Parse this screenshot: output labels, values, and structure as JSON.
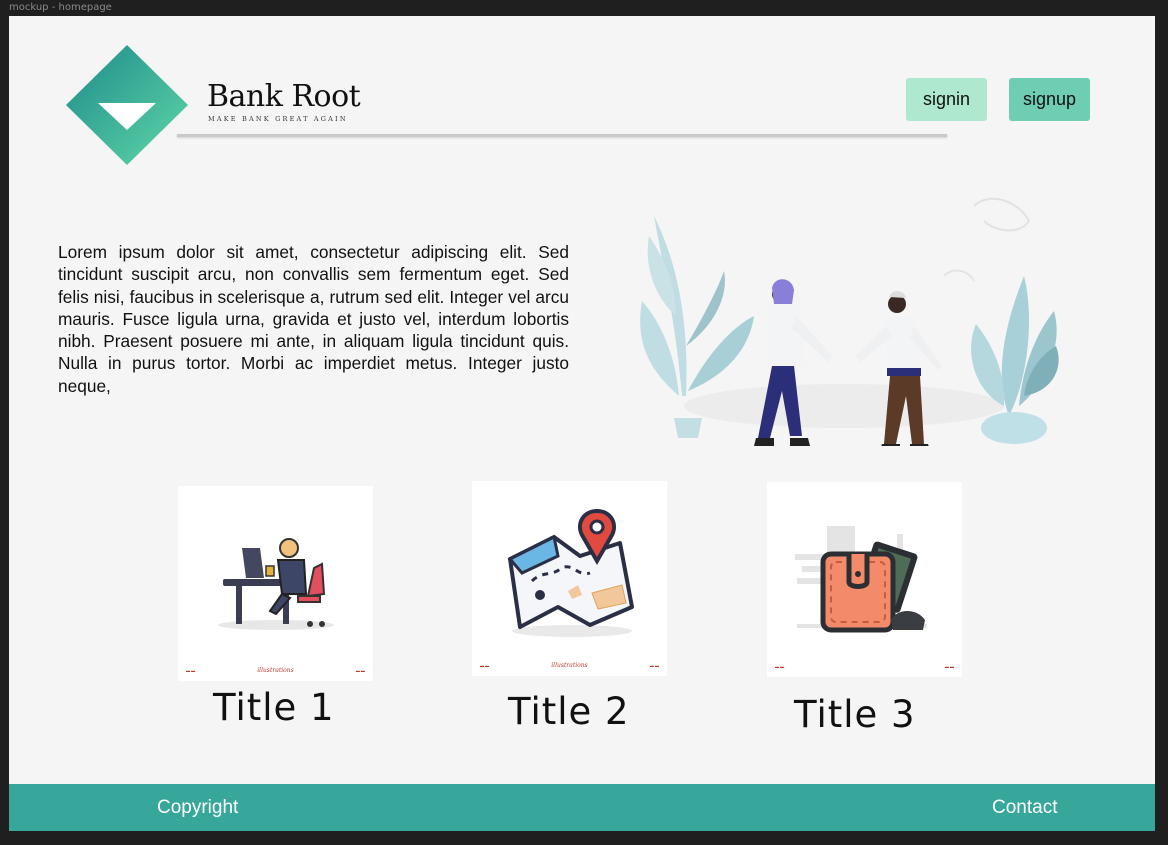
{
  "window": {
    "title": "mockup - homepage"
  },
  "brand": {
    "name": "Bank Root",
    "tagline": "MAKE BANK GREAT AGAIN",
    "gradient": [
      "#1e8a8c",
      "#5fd8a6"
    ]
  },
  "header": {
    "signin_label": "signin",
    "signup_label": "signup",
    "signin_color": "#aee8cf",
    "signup_color": "#6fcdb4"
  },
  "intro": {
    "text": "Lorem ipsum dolor sit amet, consectetur adipiscing elit. Sed tincidunt suscipit arcu, non convallis sem fermentum eget. Sed felis nisi, faucibus in scelerisque a, rutrum sed elit. Integer vel arcu mauris. Fusce ligula urna, gravida et justo vel, interdum lobortis nibh. Praesent posuere mi ante, in aliquam ligula tincidunt quis. Nulla in purus tortor. Morbi ac imperdiet metus. Integer justo neque,"
  },
  "cards": [
    {
      "title": "Title 1",
      "icon": "person-at-desk-icon",
      "footer_mid": "illustrations"
    },
    {
      "title": "Title 2",
      "icon": "map-pin-icon",
      "footer_mid": "illustrations"
    },
    {
      "title": "Title 3",
      "icon": "wallet-icon",
      "footer_mid": ""
    }
  ],
  "footer": {
    "copyright_label": "Copyright",
    "contact_label": "Contact",
    "color": "#36a79a"
  }
}
